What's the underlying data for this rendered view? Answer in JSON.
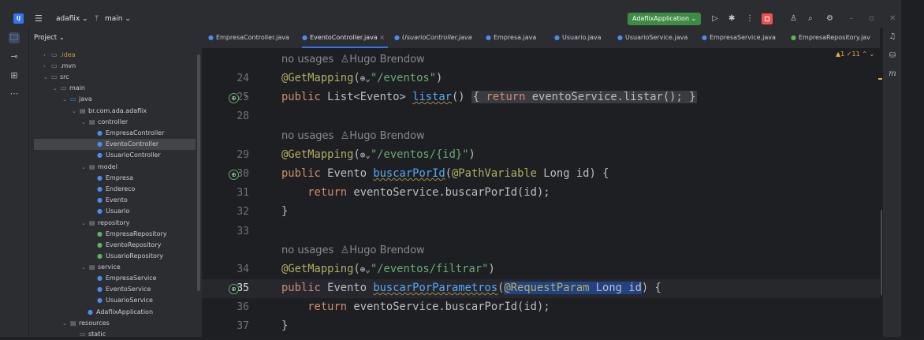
{
  "titlebar": {
    "logo": "IJ",
    "project_name": "adaflix ⌄",
    "branch": "main ⌄",
    "run_config": "AdaflixApplication ⌄",
    "icons": [
      "hamburger-icon",
      "branch-icon",
      "run-icon",
      "debug-icon",
      "more-icon",
      "stop-icon",
      "user-icon",
      "search-icon",
      "gear-icon",
      "minimize-icon",
      "restore-icon",
      "close-icon"
    ]
  },
  "project": {
    "header": "Project ⌄",
    "tree": [
      {
        "label": ".idea",
        "kind": "folder-excluded"
      },
      {
        "label": ".mvn",
        "kind": "folder"
      },
      {
        "label": "src",
        "kind": "folder"
      },
      {
        "label": "main",
        "kind": "folder"
      },
      {
        "label": "java",
        "kind": "folder"
      },
      {
        "label": "br.com.ada.adaflix",
        "kind": "package"
      },
      {
        "label": "controller",
        "kind": "package"
      },
      {
        "label": "EmpresaController",
        "kind": "class"
      },
      {
        "label": "EventoController",
        "kind": "class",
        "selected": true
      },
      {
        "label": "UsuarioController",
        "kind": "class"
      },
      {
        "label": "model",
        "kind": "package"
      },
      {
        "label": "Empresa",
        "kind": "class"
      },
      {
        "label": "Endereco",
        "kind": "class"
      },
      {
        "label": "Evento",
        "kind": "class"
      },
      {
        "label": "Usuario",
        "kind": "class"
      },
      {
        "label": "repository",
        "kind": "package"
      },
      {
        "label": "EmpresaRepository",
        "kind": "interface"
      },
      {
        "label": "EventoRepository",
        "kind": "interface"
      },
      {
        "label": "UsuarioRepository",
        "kind": "interface"
      },
      {
        "label": "service",
        "kind": "package"
      },
      {
        "label": "EmpresaService",
        "kind": "class"
      },
      {
        "label": "EventoService",
        "kind": "class"
      },
      {
        "label": "UsuarioService",
        "kind": "class"
      },
      {
        "label": "AdaflixApplication",
        "kind": "class"
      },
      {
        "label": "resources",
        "kind": "folder"
      },
      {
        "label": "static",
        "kind": "folder"
      }
    ]
  },
  "tabs": [
    {
      "label": "EmpresaController.java"
    },
    {
      "label": "EventoController.java",
      "active": true,
      "close": "×"
    },
    {
      "label": "UsuarioController.java",
      "italic": true
    },
    {
      "label": "Empresa.java"
    },
    {
      "label": "Usuario.java"
    },
    {
      "label": "UsuarioService.java"
    },
    {
      "label": "EmpresaService.java"
    },
    {
      "label": "EmpresaRepository.jav"
    }
  ],
  "inspections": "▲1 ✓11 ⌃ ⌄",
  "editor": {
    "hint_usages": "no usages",
    "hint_author": "Hugo Brendow",
    "lines": {
      "l24": "24",
      "l25": "25",
      "l28": "28",
      "l29": "29",
      "l30": "30",
      "l31": "31",
      "l32": "32",
      "l33": "33",
      "l34": "34",
      "l35": "35",
      "l36": "36",
      "l37": "37"
    },
    "code": {
      "ann_get": "@GetMapping",
      "path1": "\"/eventos\"",
      "path2": "\"/eventos/{id}\"",
      "path3": "\"/eventos/filtrar\"",
      "public": "public",
      "list_type": "List<Evento>",
      "listar": "listar",
      "return": "return",
      "listar_body": "eventoService.listar();",
      "evento_type": "Evento",
      "buscar_por_id": "buscarPorId",
      "path_variable": "@PathVariable",
      "long_id": "Long id",
      "return_call": "eventoService.buscarPorId(id);",
      "buscar_por_parametros": "buscarPorParametros",
      "request_param": "@RequestParam",
      "long_id_selected": "Long id"
    }
  }
}
